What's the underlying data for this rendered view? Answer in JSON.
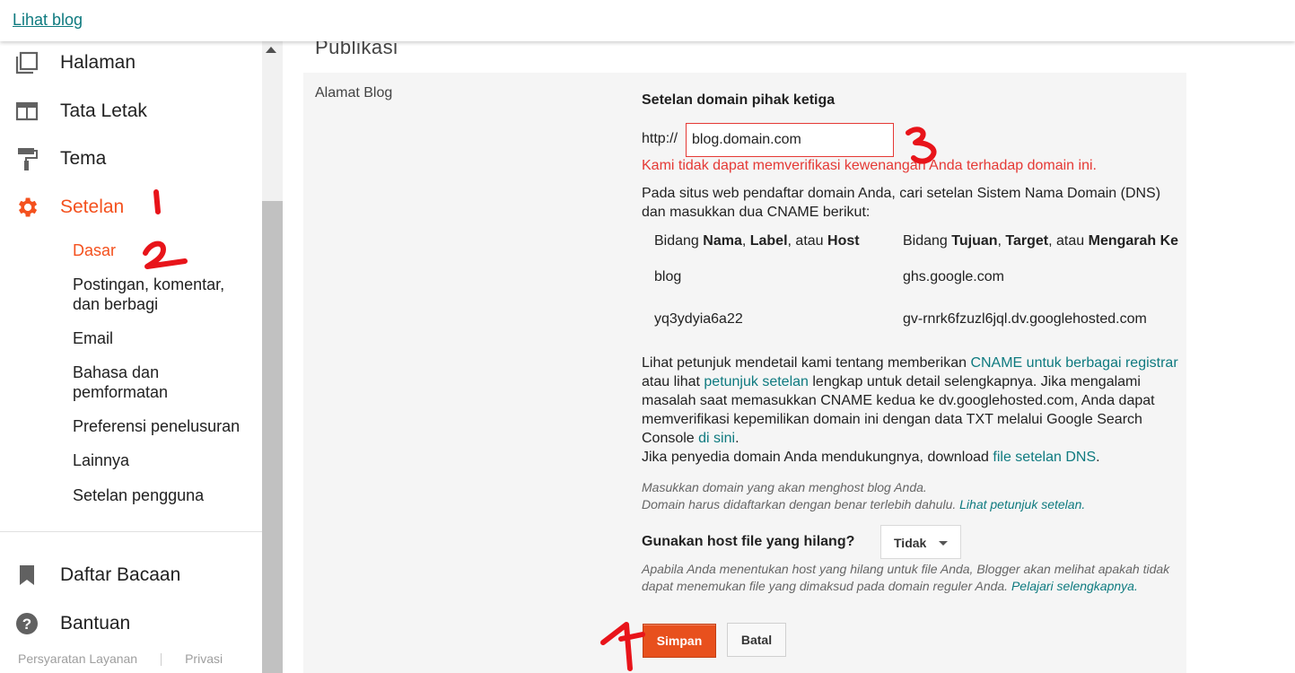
{
  "topbar": {
    "view_blog": "Lihat blog"
  },
  "sidebar": {
    "items": [
      {
        "label": "Halaman",
        "icon": "pages-icon"
      },
      {
        "label": "Tata Letak",
        "icon": "layout-icon"
      },
      {
        "label": "Tema",
        "icon": "theme-roller-icon"
      },
      {
        "label": "Setelan",
        "icon": "gear-icon"
      }
    ],
    "sub_items": [
      "Dasar",
      "Postingan, komentar,",
      "dan berbagi",
      "Email",
      "Bahasa dan",
      "pemformatan",
      "Preferensi penelusuran",
      "Lainnya",
      "Setelan pengguna"
    ],
    "bottom_items": [
      {
        "label": "Daftar Bacaan",
        "icon": "bookmark-icon"
      },
      {
        "label": "Bantuan",
        "icon": "help-icon"
      }
    ],
    "footer": {
      "terms": "Persyaratan Layanan",
      "privacy": "Privasi"
    },
    "active_color": "#f4511e"
  },
  "main": {
    "title": "Publikasi",
    "field_label": "Alamat Blog",
    "section_heading": "Setelan domain pihak ketiga",
    "http_prefix": "http://",
    "domain_value": "blog.domain.com",
    "error": "Kami tidak dapat memverifikasi kewenangan Anda terhadap domain ini.",
    "instructions": "Pada situs web pendaftar domain Anda, cari setelan Sistem Nama Domain (DNS) dan masukkan dua CNAME berikut:",
    "cname_table": {
      "col1": {
        "pre": "Bidang ",
        "b1": "Nama",
        "m1": ", ",
        "b2": "Label",
        "m2": ", atau ",
        "b3": "Host"
      },
      "col2": {
        "pre": "Bidang ",
        "b1": "Tujuan",
        "m1": ", ",
        "b2": "Target",
        "m2": ", atau ",
        "b3": "Mengarah Ke"
      },
      "rows": [
        {
          "name": "blog",
          "target": "ghs.google.com"
        },
        {
          "name": "yq3ydyia6a22",
          "target": "gv-rnrk6fzuzl6jql.dv.googlehosted.com"
        }
      ]
    },
    "details": {
      "t1": "Lihat petunjuk mendetail kami tentang memberikan ",
      "l1": "CNAME untuk berbagai registrar",
      "t2": " atau lihat ",
      "l2": "petunjuk setelan",
      "t3": " lengkap untuk detail selengkapnya. Jika mengalami masalah saat memasukkan CNAME kedua ke dv.googlehosted.com, Anda dapat memverifikasi kepemilikan domain ini dengan data TXT melalui Google Search Console ",
      "l3": "di sini",
      "t4": ".",
      "t5": "Jika penyedia domain Anda mendukungnya, download ",
      "l4": "file setelan DNS",
      "t6": "."
    },
    "hint": {
      "line1": "Masukkan domain yang akan menghost blog Anda.",
      "line2": "Domain harus didaftarkan dengan benar terlebih dahulu. ",
      "link": "Lihat petunjuk setelan."
    },
    "missing_host": {
      "label": "Gunakan host file yang hilang?",
      "value": "Tidak",
      "hint": "Apabila Anda menentukan host yang hilang untuk file Anda, Blogger akan melihat apakah tidak dapat menemukan file yang dimaksud pada domain reguler Anda. ",
      "link": "Pelajari selengkapnya."
    },
    "buttons": {
      "save": "Simpan",
      "cancel": "Batal"
    }
  }
}
